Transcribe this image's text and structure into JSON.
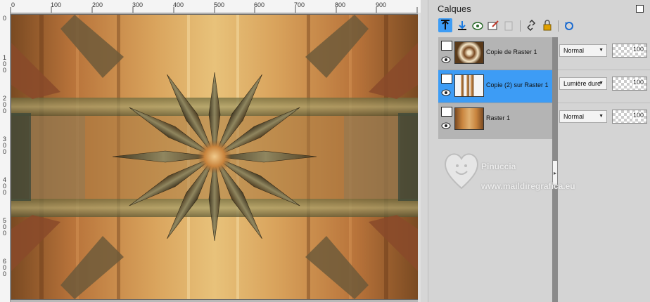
{
  "ruler": {
    "top_labels": [
      "0",
      "100",
      "200",
      "300",
      "400",
      "500",
      "600",
      "700",
      "800",
      "900"
    ],
    "left_labels": [
      "0",
      "1\n0\n0",
      "2\n0\n0",
      "3\n0\n0",
      "4\n0\n0",
      "5\n0\n0",
      "6\n0\n0"
    ]
  },
  "panel": {
    "title": "Calques",
    "toolbar_icons": [
      "new-raster-layer-icon",
      "arrange-down-icon",
      "new-mask-icon",
      "new-adjustment-icon",
      "delete-layer-icon",
      "link-icon",
      "lock-icon",
      "undo-icon"
    ]
  },
  "layers": [
    {
      "name": "Copie de Raster 1",
      "blend": "Normal",
      "opacity": "100",
      "selected": false
    },
    {
      "name": "Copie (2) sur Raster 1",
      "blend": "Lumière dure",
      "opacity": "100",
      "selected": true
    },
    {
      "name": "Raster 1",
      "blend": "Normal",
      "opacity": "100",
      "selected": false
    }
  ],
  "watermark": {
    "line1": "Pinuccia",
    "line2": "www.maildiregrafica.eu"
  },
  "colors": {
    "selected": "#3d9cf5",
    "panel": "#d4d4d4",
    "layer_bg": "#b4b4b4"
  }
}
